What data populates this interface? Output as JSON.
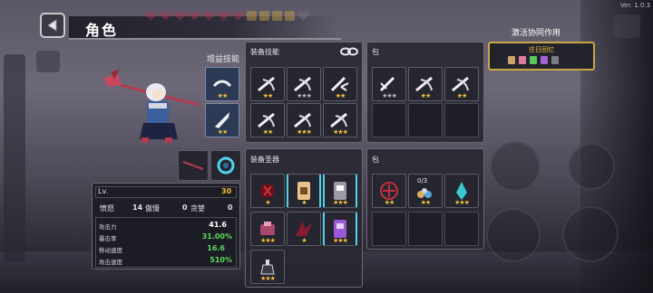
{
  "header": {
    "title": "角色",
    "version": "Ver. 1.0.3"
  },
  "skills": {
    "label": "增益技能",
    "slots": [
      {
        "stars": "★★"
      },
      {
        "stars": "★★"
      }
    ]
  },
  "stats": {
    "lv_label": "Lv.",
    "lv_value": "30",
    "anger_label": "愤怒",
    "anger_value": "14",
    "pride_label": "傲慢",
    "pride_value": "0",
    "greed_label": "贪婪",
    "greed_value": "0",
    "rows": [
      {
        "name": "攻击力",
        "value": "41.6",
        "color": "#ffffff"
      },
      {
        "name": "暴击率",
        "value": "31.00%",
        "color": "#5bd85a"
      },
      {
        "name": "移动速度",
        "value": "16.6",
        "color": "#5bd85a"
      },
      {
        "name": "攻击速度",
        "value": "510%",
        "color": "#5bd85a"
      }
    ]
  },
  "equip_skills": {
    "title": "装备技能",
    "stars_row1": [
      "★★",
      "★★★",
      "★★"
    ],
    "stars_row2": [
      "★★",
      "★★★",
      "★★★"
    ]
  },
  "bag_top": {
    "title": "包",
    "stars": [
      "★★★",
      "★★",
      "★★"
    ]
  },
  "equip_relics": {
    "title": "装备圣器",
    "stars_row1": [
      "★",
      "★",
      "★★★"
    ],
    "stars_row2": [
      "★★★",
      "★",
      "★★★"
    ],
    "stars_row3": [
      "★★★"
    ]
  },
  "bag_bottom": {
    "title": "包",
    "counter": "0/3",
    "stars": [
      "★★",
      "★★",
      "★★★"
    ]
  },
  "synergy": {
    "label": "激活协同作用",
    "name": "往日回忆",
    "icon_colors": [
      "#c9a36b",
      "#e07aa0",
      "#58c95a",
      "#a860d8",
      "#7a7a86"
    ]
  }
}
